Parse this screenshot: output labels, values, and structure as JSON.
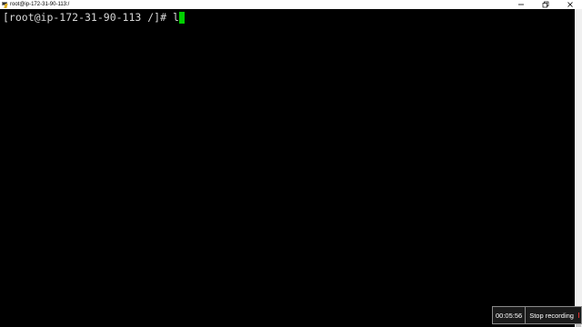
{
  "window": {
    "title": "root@ip-172-31-90-113:/",
    "icon": "putty-icon",
    "controls": [
      "minimize-icon",
      "restore-icon",
      "close-icon"
    ]
  },
  "terminal": {
    "prompt": "[root@ip-172-31-90-113 /]# ",
    "typed": "l",
    "cursor_color": "#00d000",
    "text_color": "#d8d8d8",
    "background": "#000000"
  },
  "recording": {
    "elapsed": "00:05:56",
    "stop_label": "Stop recording",
    "stop_color": "#e03030"
  }
}
